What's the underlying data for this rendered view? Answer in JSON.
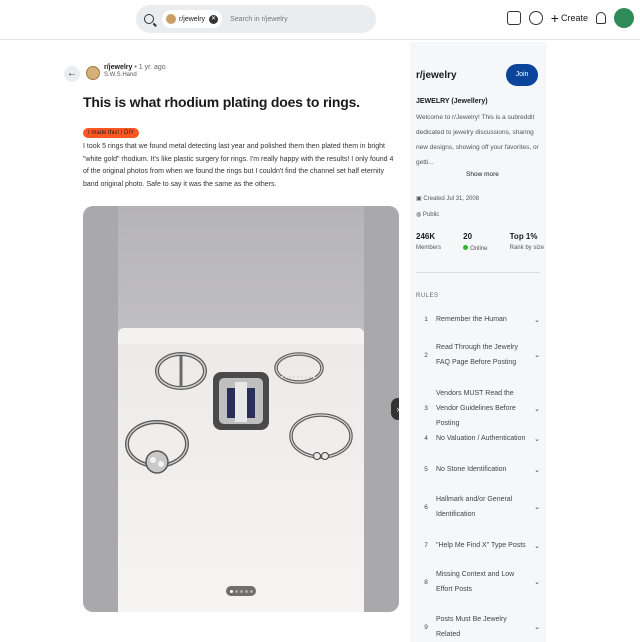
{
  "header": {
    "subreddit_chip": "r/jewelry",
    "search_placeholder": "Search in r/jewelry",
    "create_label": "Create"
  },
  "post": {
    "subreddit": "r/jewelry",
    "time": "• 1 yr. ago",
    "author": "S.W.S.Hand",
    "title": "This is what rhodium plating does to rings.",
    "flair": "I made this! / DIY",
    "body": "I took 5 rings that we found metal detecting last year and polished them then plated them in bright \"white gold\" rhodium. It's like plastic surgery for rings. I'm really happy with the results! I only found 4 of the original photos from when we found the rings but I couldn't find the channel set half eternity band original photo. Safe to say it was the same as the others."
  },
  "sidebar": {
    "name": "r/jewelry",
    "join_label": "Join",
    "full_name": "JEWELRY (Jewellery)",
    "description": "Welcome to r/Jewelry! This is a subreddit dedicated to jewelry discussions, sharing new designs, showing off your favorites, or getti...",
    "show_more": "Show more",
    "created": "Created Jul 31, 2008",
    "visibility": "Public",
    "stats": [
      {
        "value": "246K",
        "label": "Members"
      },
      {
        "value": "20",
        "label": "Online"
      },
      {
        "value": "Top 1%",
        "label": "Rank by size"
      }
    ],
    "rules_heading": "RULES",
    "rules": [
      {
        "n": "1",
        "text": "Remember the Human"
      },
      {
        "n": "2",
        "text": "Read Through the Jewelry FAQ Page Before Posting"
      },
      {
        "n": "3",
        "text": "Vendors MUST Read the Vendor Guidelines Before Posting"
      },
      {
        "n": "4",
        "text": "No Valuation / Authentication"
      },
      {
        "n": "5",
        "text": "No Stone Identification"
      },
      {
        "n": "6",
        "text": "Hallmark and/or General Identification"
      },
      {
        "n": "7",
        "text": "\"Help Me Find X\" Type Posts"
      },
      {
        "n": "8",
        "text": "Missing Context and Low Effort Posts"
      },
      {
        "n": "9",
        "text": "Posts Must Be Jewelry Related"
      }
    ]
  },
  "colors": {
    "join": "#0a449b",
    "flair": "#ff5722",
    "online": "#2eb82e"
  }
}
